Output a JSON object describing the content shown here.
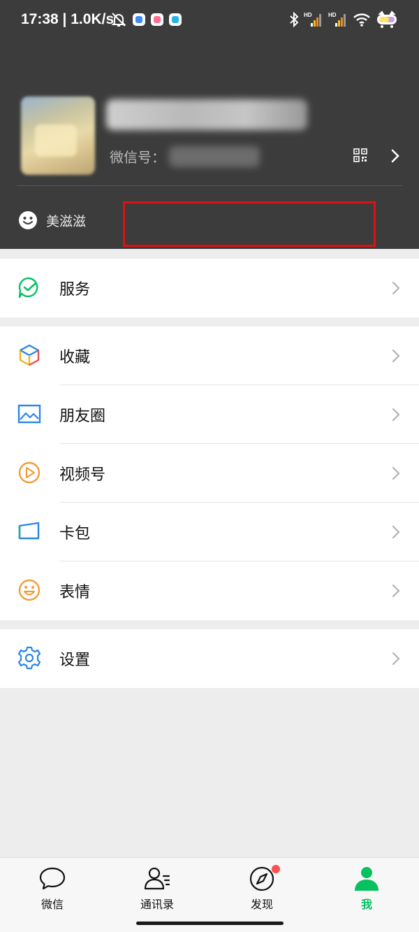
{
  "status_bar": {
    "time": "17:38 | 1.0K/s",
    "left_icons": [
      "mute-bell-icon",
      "app-blue-icon",
      "app-pink-icon",
      "app-cyan-icon"
    ],
    "right_icons": [
      "bluetooth-icon",
      "signal-hd-1-icon",
      "signal-hd-2-icon",
      "wifi-icon",
      "battery-icon"
    ]
  },
  "profile": {
    "wechat_id_label": "微信号：",
    "status_text": "美滋滋"
  },
  "menu": {
    "group1": [
      {
        "label": "服务",
        "icon": "service-icon"
      }
    ],
    "group2": [
      {
        "label": "收藏",
        "icon": "favorites-cube-icon"
      },
      {
        "label": "朋友圈",
        "icon": "moments-photo-icon"
      },
      {
        "label": "视频号",
        "icon": "channels-play-icon"
      },
      {
        "label": "卡包",
        "icon": "card-wallet-icon"
      },
      {
        "label": "表情",
        "icon": "sticker-smile-icon"
      }
    ],
    "group3": [
      {
        "label": "设置",
        "icon": "settings-gear-icon"
      }
    ]
  },
  "tabbar": {
    "tabs": [
      {
        "label": "微信",
        "icon": "chat-bubble-icon",
        "active": false
      },
      {
        "label": "通讯录",
        "icon": "contacts-icon",
        "active": false
      },
      {
        "label": "发现",
        "icon": "discover-compass-icon",
        "active": false,
        "badge": true
      },
      {
        "label": "我",
        "icon": "me-person-icon",
        "active": true
      }
    ]
  },
  "colors": {
    "header_bg": "#3c3c3c",
    "wechat_green": "#07c160",
    "badge_red": "#fa5151",
    "highlight_red": "#dd1111",
    "page_bg": "#ededed"
  }
}
